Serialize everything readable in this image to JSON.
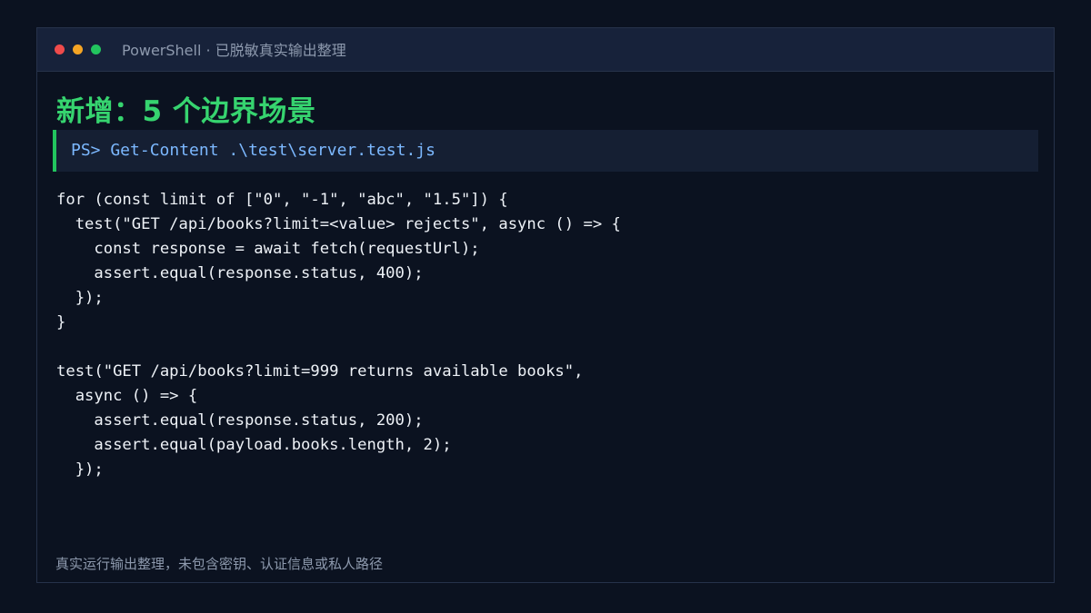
{
  "window": {
    "title_app": "PowerShell",
    "title_separator": "·",
    "title_subtitle": "已脱敏真实输出整理"
  },
  "heading": "新增：5 个边界场景",
  "command": "PS> Get-Content .\\test\\server.test.js",
  "code_lines": [
    "for (const limit of [\"0\", \"-1\", \"abc\", \"1.5\"]) {",
    "  test(\"GET /api/books?limit=<value> rejects\", async () => {",
    "    const response = await fetch(requestUrl);",
    "    assert.equal(response.status, 400);",
    "  });",
    "}",
    "",
    "test(\"GET /api/books?limit=999 returns available books\",",
    "  async () => {",
    "    assert.equal(response.status, 200);",
    "    assert.equal(payload.books.length, 2);",
    "  });"
  ],
  "footer": "真实运行输出整理，未包含密钥、认证信息或私人路径",
  "colors": {
    "background": "#0b1220",
    "titlebar": "#17223a",
    "heading": "#36d46f",
    "command_accent": "#22c55e",
    "command_text": "#7cb8ff",
    "code_text": "#eef2f7",
    "muted_text": "#8d99ad",
    "dot_close": "#ef4b4b",
    "dot_minimize": "#f5a524",
    "dot_maximize": "#22c55e"
  }
}
